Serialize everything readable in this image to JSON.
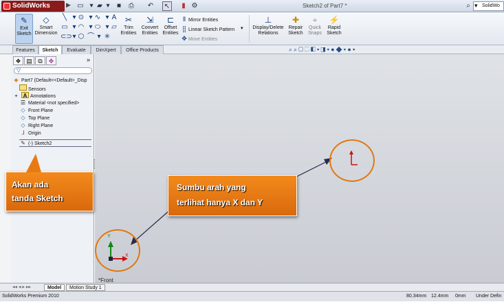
{
  "app": {
    "logo_text": "SolidWorks",
    "document_title": "Sketch2 of Part7 *",
    "search_text": "SolidWo"
  },
  "command_manager": {
    "exit_sketch": "Exit Sketch",
    "smart_dimension": "Smart Dimension",
    "trim_entities": "Trim Entities",
    "convert_entities": "Convert Entities",
    "offset_entities": "Offset Entities",
    "mirror_entities": "Mirror Entities",
    "linear_sketch_pattern": "Linear Sketch Pattern",
    "move_entities": "Move Entities",
    "display_delete_relations": "Display/Delete Relations",
    "repair_sketch": "Repair Sketch",
    "quick_snaps": "Quick Snaps",
    "rapid_sketch": "Rapid Sketch"
  },
  "tabs": [
    "Features",
    "Sketch",
    "Evaluate",
    "DimXpert",
    "Office Products"
  ],
  "feature_tree": {
    "root": "Part7  (Default<<Default>_Disp",
    "items": [
      "Sensors",
      "Annotations",
      "Material <not specified>",
      "Front Plane",
      "Top Plane",
      "Right Plane",
      "Origin",
      "(-) Sketch2"
    ]
  },
  "viewport": {
    "view_label": "*Front",
    "axis_x": "X",
    "axis_y": "Y"
  },
  "callouts": {
    "left_line1": "Akan ada",
    "left_line2": "tanda Sketch",
    "right_line1": "Sumbu arah yang",
    "right_line2": "terlihat hanya X dan Y"
  },
  "bottom_tabs": [
    "Model",
    "Motion Study 1"
  ],
  "status": {
    "product": "SolidWorks Premium 2010",
    "x": "80.34mm",
    "y": "12.4mm",
    "z": "0mm",
    "state": "Under Defin"
  },
  "colors": {
    "callout": "#e87a14",
    "axis_x": "#cc1111",
    "axis_y": "#118811"
  }
}
